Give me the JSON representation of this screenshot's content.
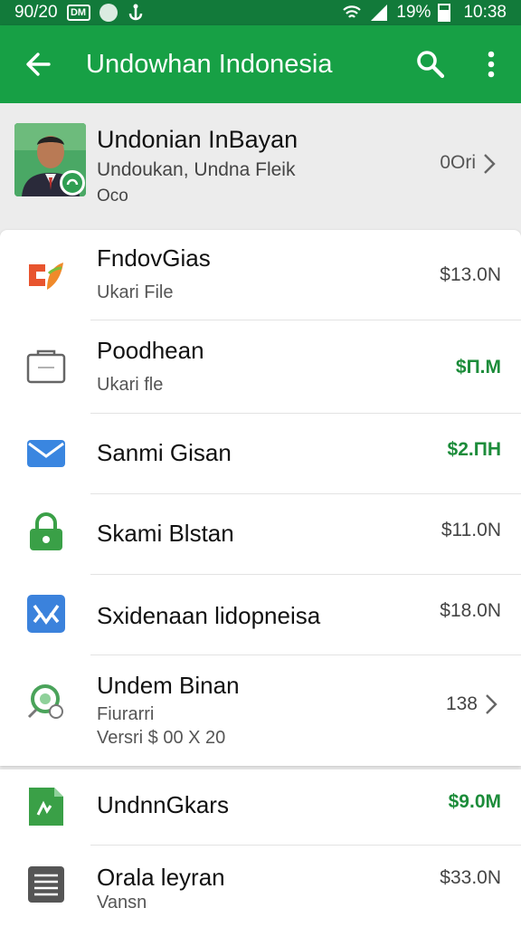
{
  "status_bar": {
    "left_text": "90/20",
    "mini_badge": "DM",
    "battery": "19%",
    "time": "10:38"
  },
  "app_bar": {
    "title": "Undowhan Indonesia",
    "back_icon": "arrow-left-icon",
    "search_icon": "search-icon",
    "more_icon": "more-vert-icon"
  },
  "profile": {
    "name": "Undonian InBayan",
    "sub1": "Undoukan, Undna Fleik",
    "sub2": "Oco",
    "count": "0Ori"
  },
  "items": [
    {
      "title": "FndovGias",
      "subtitle": "Ukari File",
      "price": "$13.0N",
      "price_green": false,
      "icon": "leaf-logo-icon"
    },
    {
      "title": "Poodhean",
      "subtitle": "Ukari fle",
      "price": "$П.M",
      "price_green": true,
      "icon": "folder-outline-icon"
    },
    {
      "title": "Sanmi Gisan",
      "subtitle": "",
      "price": "$2.ПH",
      "price_green": true,
      "icon": "mail-icon"
    },
    {
      "title": "Skami Blstan",
      "subtitle": "",
      "price": "$11.0N",
      "price_green": false,
      "icon": "lock-icon"
    },
    {
      "title": "Sxidenaan lidopneisa",
      "subtitle": "",
      "price": "$18.0N",
      "price_green": false,
      "icon": "x-app-icon"
    },
    {
      "title": "Undem Binan",
      "subtitle": "Fiurarri",
      "subtitle2": "Versri $ 00 X 20",
      "price": "138",
      "price_green": false,
      "icon": "search-circle-icon",
      "chevron": true
    }
  ],
  "items2": [
    {
      "title": "UndnnGkars",
      "subtitle": "",
      "price": "$9.0M",
      "price_green": true,
      "icon": "document-green-icon"
    },
    {
      "title": "Orala leyran",
      "subtitle": "Vansn",
      "price": "$33.0N",
      "price_green": false,
      "icon": "list-document-icon"
    }
  ],
  "colors": {
    "status_bar": "#127a3a",
    "app_bar": "#17a045",
    "price_green": "#1c8c3a"
  }
}
